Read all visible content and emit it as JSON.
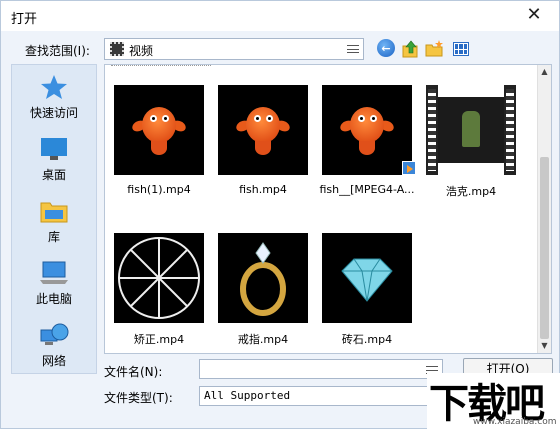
{
  "window": {
    "title": "打开",
    "close_glyph": "✕"
  },
  "lookin": {
    "label": "查找范围(I):",
    "value": "视频"
  },
  "toolbar": {
    "icons": [
      "back-icon",
      "up-folder-icon",
      "new-folder-icon",
      "view-menu-icon"
    ]
  },
  "places": [
    {
      "label": "快速访问",
      "icon": "star-icon"
    },
    {
      "label": "桌面",
      "icon": "desktop-icon"
    },
    {
      "label": "库",
      "icon": "library-icon"
    },
    {
      "label": "此电脑",
      "icon": "computer-icon"
    },
    {
      "label": "网络",
      "icon": "network-icon"
    }
  ],
  "files": [
    {
      "name": "fish(1).mp4",
      "thumb": "fish"
    },
    {
      "name": "fish.mp4",
      "thumb": "fish"
    },
    {
      "name": "fish__[MPEG4-A...",
      "thumb": "fish-badge"
    },
    {
      "name": "浩克.mp4",
      "thumb": "film"
    },
    {
      "name": "矫正.mp4",
      "thumb": "wheel"
    },
    {
      "name": "戒指.mp4",
      "thumb": "ring"
    },
    {
      "name": "砖石.mp4",
      "thumb": "diamond"
    }
  ],
  "filename": {
    "label": "文件名(N):",
    "value": ""
  },
  "filetype": {
    "label": "文件类型(T):",
    "value": "All Supported"
  },
  "buttons": {
    "open": "打开(O)"
  },
  "watermark": {
    "brand": "下载吧",
    "url": "www.xiazaiba.com"
  }
}
